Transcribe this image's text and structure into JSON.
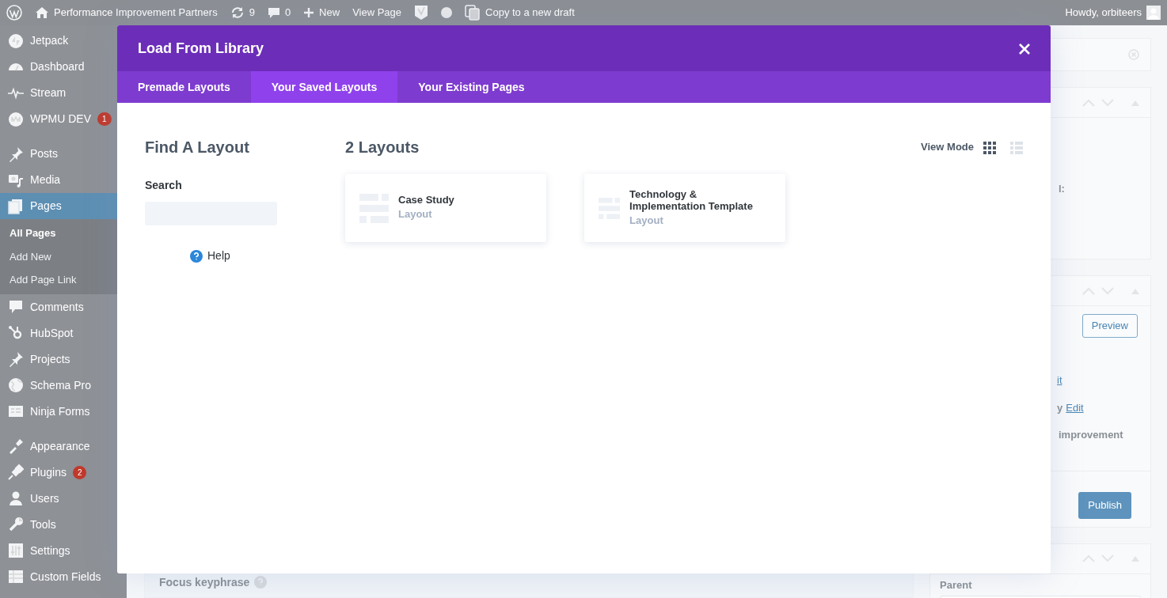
{
  "admin_bar": {
    "site_name": "Performance Improvement Partners",
    "updates": "9",
    "comments": "0",
    "new": "New",
    "view_page": "View Page",
    "copy_draft": "Copy to a new draft",
    "greeting": "Howdy, orbiteers"
  },
  "sidebar": {
    "groups": [
      [
        {
          "label": "Jetpack",
          "selected": false
        },
        {
          "label": "Dashboard",
          "selected": false
        },
        {
          "label": "Stream",
          "selected": false
        },
        {
          "label": "WPMU DEV",
          "selected": false,
          "badge": "1"
        }
      ],
      [
        {
          "label": "Posts",
          "selected": false
        },
        {
          "label": "Media",
          "selected": false
        },
        {
          "label": "Pages",
          "selected": true,
          "children": [
            {
              "label": "All Pages",
              "selected": true
            },
            {
              "label": "Add New",
              "selected": false
            },
            {
              "label": "Add Page Link",
              "selected": false
            }
          ]
        },
        {
          "label": "Comments",
          "selected": false
        },
        {
          "label": "HubSpot",
          "selected": false
        },
        {
          "label": "Projects",
          "selected": false
        },
        {
          "label": "Schema Pro",
          "selected": false
        },
        {
          "label": "Ninja Forms",
          "selected": false
        }
      ],
      [
        {
          "label": "Appearance",
          "selected": false
        },
        {
          "label": "Plugins",
          "selected": false,
          "badge": "2"
        },
        {
          "label": "Users",
          "selected": false
        },
        {
          "label": "Tools",
          "selected": false
        },
        {
          "label": "Settings",
          "selected": false
        },
        {
          "label": "Custom Fields",
          "selected": false
        }
      ]
    ]
  },
  "editor": {
    "focus_keyphrase": "Focus keyphrase"
  },
  "right_column": {
    "box_text": "l:",
    "preview": "Preview",
    "link_fragment": "it",
    "text_fragment": "y",
    "edit_link": "Edit",
    "improvement": "improvement",
    "publish": "Publish",
    "parent_label": "Parent"
  },
  "modal": {
    "title": "Load From Library",
    "tabs": [
      {
        "label": "Premade Layouts",
        "selected": false
      },
      {
        "label": "Your Saved Layouts",
        "selected": true
      },
      {
        "label": "Your Existing Pages",
        "selected": false
      }
    ],
    "sidebar": {
      "heading": "Find A Layout",
      "search_label": "Search",
      "help": "Help"
    },
    "content": {
      "heading": "2 Layouts",
      "view_mode_label": "View Mode",
      "view_modes": [
        {
          "kind": "grid",
          "selected": true
        },
        {
          "kind": "list",
          "selected": false
        }
      ],
      "layouts": [
        {
          "name": "Case Study",
          "type": "Layout"
        },
        {
          "name": "Technology & Implementation Template",
          "type": "Layout"
        }
      ]
    }
  }
}
